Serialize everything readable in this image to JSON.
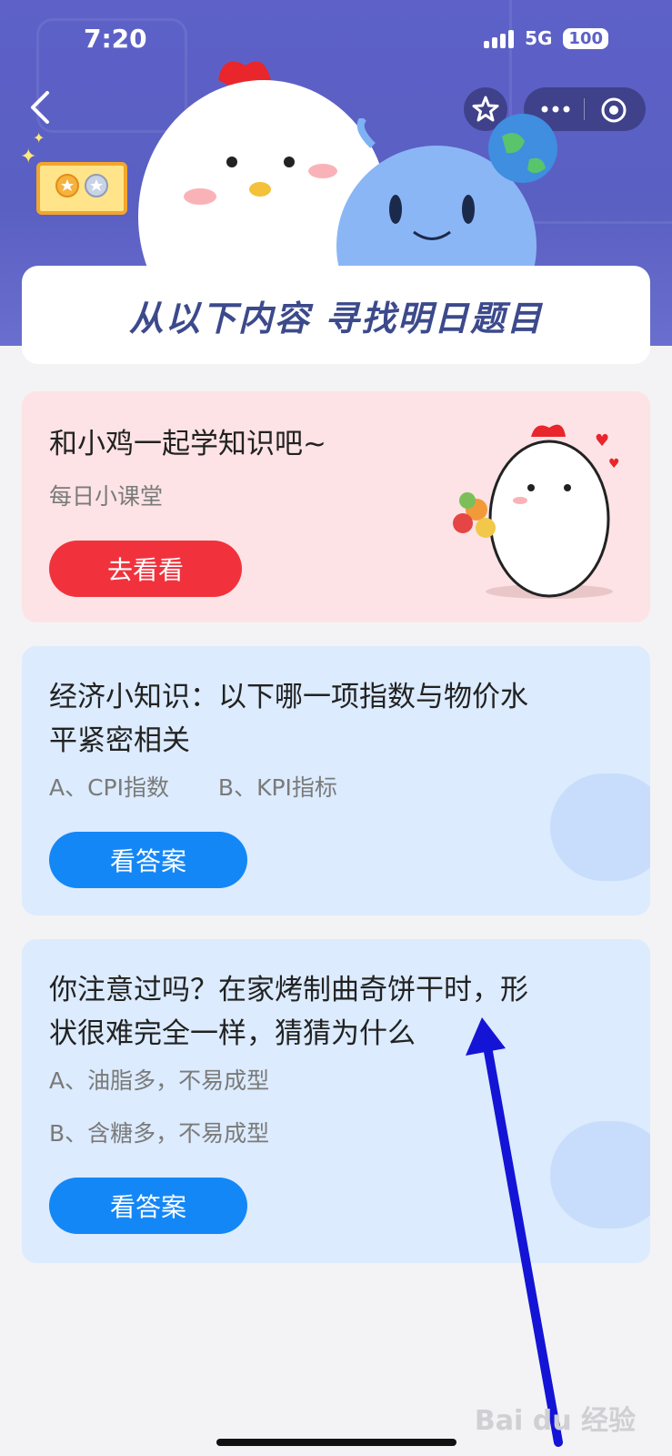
{
  "status": {
    "time": "7:20",
    "network": "5G",
    "battery": "100"
  },
  "header": {
    "banner_title": "从以下内容  寻找明日题目"
  },
  "cards": [
    {
      "title": "和小鸡一起学知识吧~",
      "subtitle": "每日小课堂",
      "button": "去看看"
    },
    {
      "title_lines": [
        "经济小知识：以下哪一项指数与物价水",
        "平紧密相关"
      ],
      "option_a": "A、CPI指数",
      "option_b": "B、KPI指标",
      "button": "看答案"
    },
    {
      "title_lines": [
        "你注意过吗？在家烤制曲奇饼干时，形",
        "状很难完全一样，猜猜为什么"
      ],
      "option_a": "A、油脂多，不易成型",
      "option_b": "B、含糖多，不易成型",
      "button": "看答案"
    }
  ],
  "watermark": "Bai du 经验",
  "icons": [
    "back-icon",
    "star-icon",
    "more-icon",
    "target-icon",
    "medal-badge-icon"
  ],
  "colors": {
    "header": "#5d61c8",
    "red_button": "#f1323c",
    "blue_button": "#1487f7",
    "pink_card": "#fde3e5",
    "blue_card": "#dcebfd",
    "arrow": "#1414d6"
  }
}
